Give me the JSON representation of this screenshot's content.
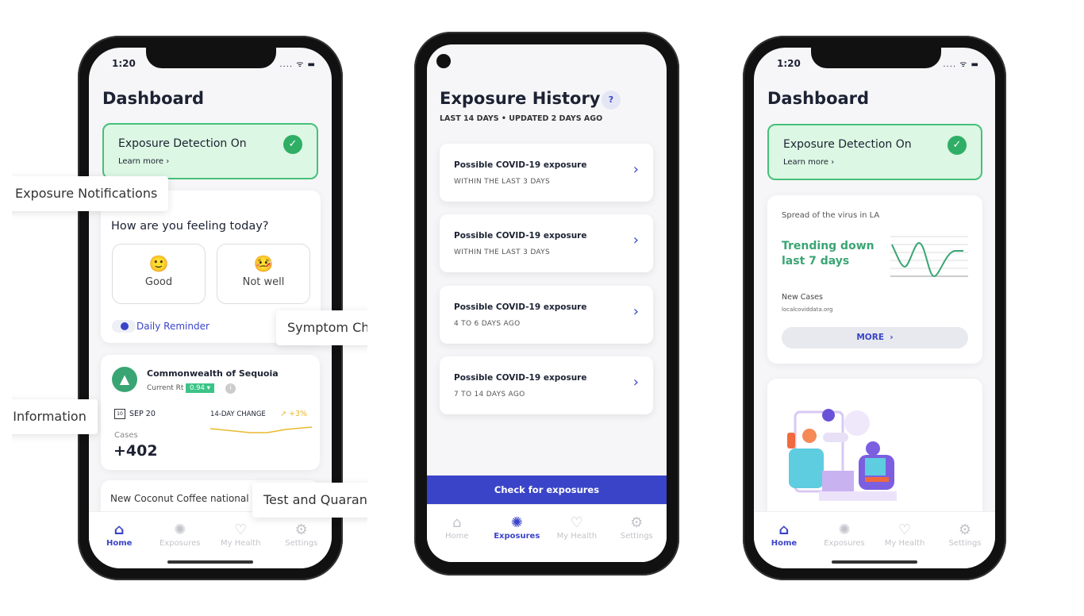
{
  "status_time": "1:20",
  "tabs": [
    {
      "label": "Home",
      "icon": "home-icon"
    },
    {
      "label": "Exposures",
      "icon": "exposures-icon"
    },
    {
      "label": "My Health",
      "icon": "heart-icon"
    },
    {
      "label": "Settings",
      "icon": "gear-icon"
    }
  ],
  "phone1": {
    "title": "Dashboard",
    "detection": {
      "title": "Exposure Detection On",
      "link": "Learn more"
    },
    "feeling": {
      "question": "How are you feeling today?",
      "options": [
        {
          "label": "Good",
          "emoji": "🙂"
        },
        {
          "label": "Not well",
          "emoji": "🤒"
        }
      ],
      "reminder": "Daily Reminder"
    },
    "region": {
      "name": "Commonwealth of Sequoia",
      "rt_label": "Current Rt",
      "rt_value": "0.94 ▾",
      "date": "SEP 20",
      "change_label": "14-DAY CHANGE",
      "change_value": "↗ +3%",
      "cases_label": "Cases",
      "cases_value": "+402"
    },
    "news": "New Coconut Coffee national"
  },
  "callouts": [
    "Exposure Notifications",
    "Symptom Che",
    "d Information",
    "Test and Quarant"
  ],
  "phone2": {
    "title": "Exposure History",
    "help": "?",
    "subtitle": "LAST 14 DAYS • UPDATED 2 DAYS AGO",
    "items": [
      {
        "title": "Possible COVID-19 exposure",
        "when": "WITHIN THE LAST 3 DAYS"
      },
      {
        "title": "Possible COVID-19 exposure",
        "when": "WITHIN THE LAST 3 DAYS"
      },
      {
        "title": "Possible COVID-19 exposure",
        "when": "4 TO 6 DAYS AGO"
      },
      {
        "title": "Possible COVID-19 exposure",
        "when": "7 TO 14 DAYS AGO"
      }
    ],
    "check_button": "Check for exposures"
  },
  "phone3": {
    "title": "Dashboard",
    "detection": {
      "title": "Exposure Detection On",
      "link": "Learn more"
    },
    "spread": {
      "title": "Spread of the virus in LA",
      "trend": "Trending down last 7 days",
      "metric": "New Cases",
      "source": "localcoviddata.org",
      "more": "MORE"
    }
  },
  "colors": {
    "accent": "#3a44c8",
    "green": "#2fae66",
    "green_bg": "#dcf7e3",
    "amber": "#e9b92c"
  }
}
